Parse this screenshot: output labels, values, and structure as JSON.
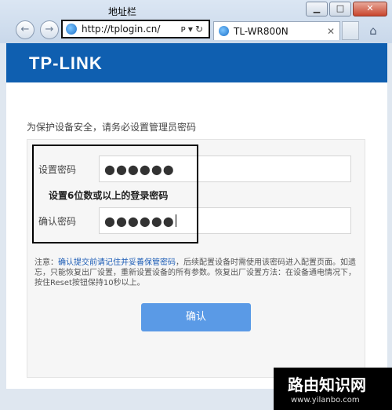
{
  "annotation": {
    "address_bar_label": "地址栏"
  },
  "window": {
    "minimize": "▁",
    "maximize": "□",
    "close": "✕"
  },
  "nav": {
    "back_icon": "back-arrow-icon",
    "forward_icon": "forward-arrow-icon"
  },
  "address": {
    "url": "http://tplogin.cn/",
    "tools": "ᴘ▾↻"
  },
  "tab": {
    "title": "TL-WR800N",
    "close": "✕"
  },
  "page": {
    "brand": "TP-LINK",
    "notice": "为保护设备安全，请务必设置管理员密码",
    "password_label": "设置密码",
    "password_value": "●●●●●●",
    "hint": "设置6位数或以上的登录密码",
    "confirm_label": "确认密码",
    "confirm_value": "●●●●●●",
    "note_prefix": "注意：",
    "note_link": "确认提交前请记住并妥善保管密码",
    "note_rest": "，后续配置设备时需使用该密码进入配置页面。如遗忘，只能恢复出厂设置，重新设置设备的所有参数。恢复出厂设置方法：在设备通电情况下，按住Reset按钮保持10秒以上。",
    "submit_button": "确认"
  },
  "watermark": {
    "title": "路由知识网",
    "url": "www.yilanbo.com"
  },
  "colors": {
    "banner": "#0f5fb0",
    "button": "#5a9ae6",
    "link": "#1a5bb5"
  }
}
